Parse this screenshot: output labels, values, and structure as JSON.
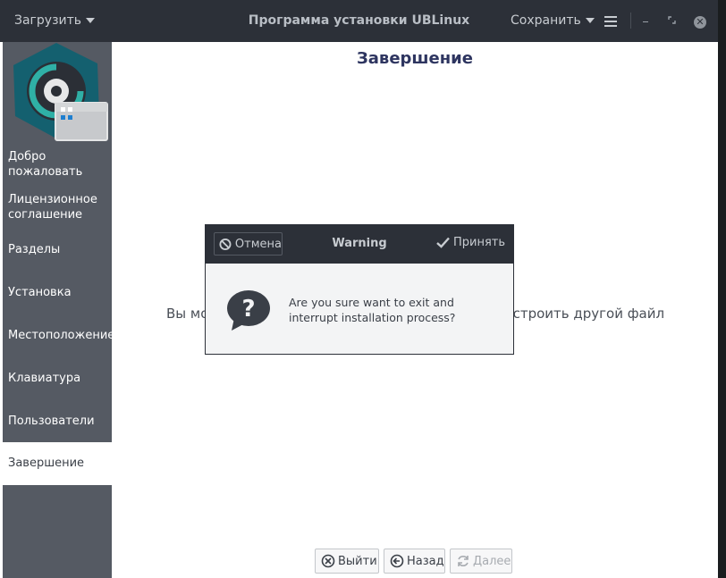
{
  "titlebar": {
    "load_menu": "Загрузить",
    "title": "Программа установки UBLinux",
    "save_menu": "Сохранить"
  },
  "sidebar": {
    "items": [
      {
        "label": "Добро\nпожаловать",
        "active": false
      },
      {
        "label": "Лицензионное\nсоглашение",
        "active": false
      },
      {
        "label": "Разделы",
        "active": false
      },
      {
        "label": "Установка",
        "active": false
      },
      {
        "label": "Местоположение",
        "active": false
      },
      {
        "label": "Клавиатура",
        "active": false
      },
      {
        "label": "Пользователи",
        "active": false
      },
      {
        "label": "Завершение",
        "active": true
      }
    ]
  },
  "main": {
    "title": "Завершение",
    "bg_text_left": "Вы мо",
    "bg_text_right": "астроить другой файл"
  },
  "dialog": {
    "cancel_label": "Отмена",
    "title": "Warning",
    "accept_label": "Принять",
    "message_line1": "Are you sure want to exit and",
    "message_line2": "interrupt installation process?"
  },
  "footer": {
    "exit_label": "Выйти",
    "back_label": "Назад",
    "next_label": "Далее"
  },
  "colors": {
    "titlebar": "#2c3038",
    "sidebar": "#555a63",
    "logo_hex": "#14606f",
    "accent": "#2e3560"
  }
}
